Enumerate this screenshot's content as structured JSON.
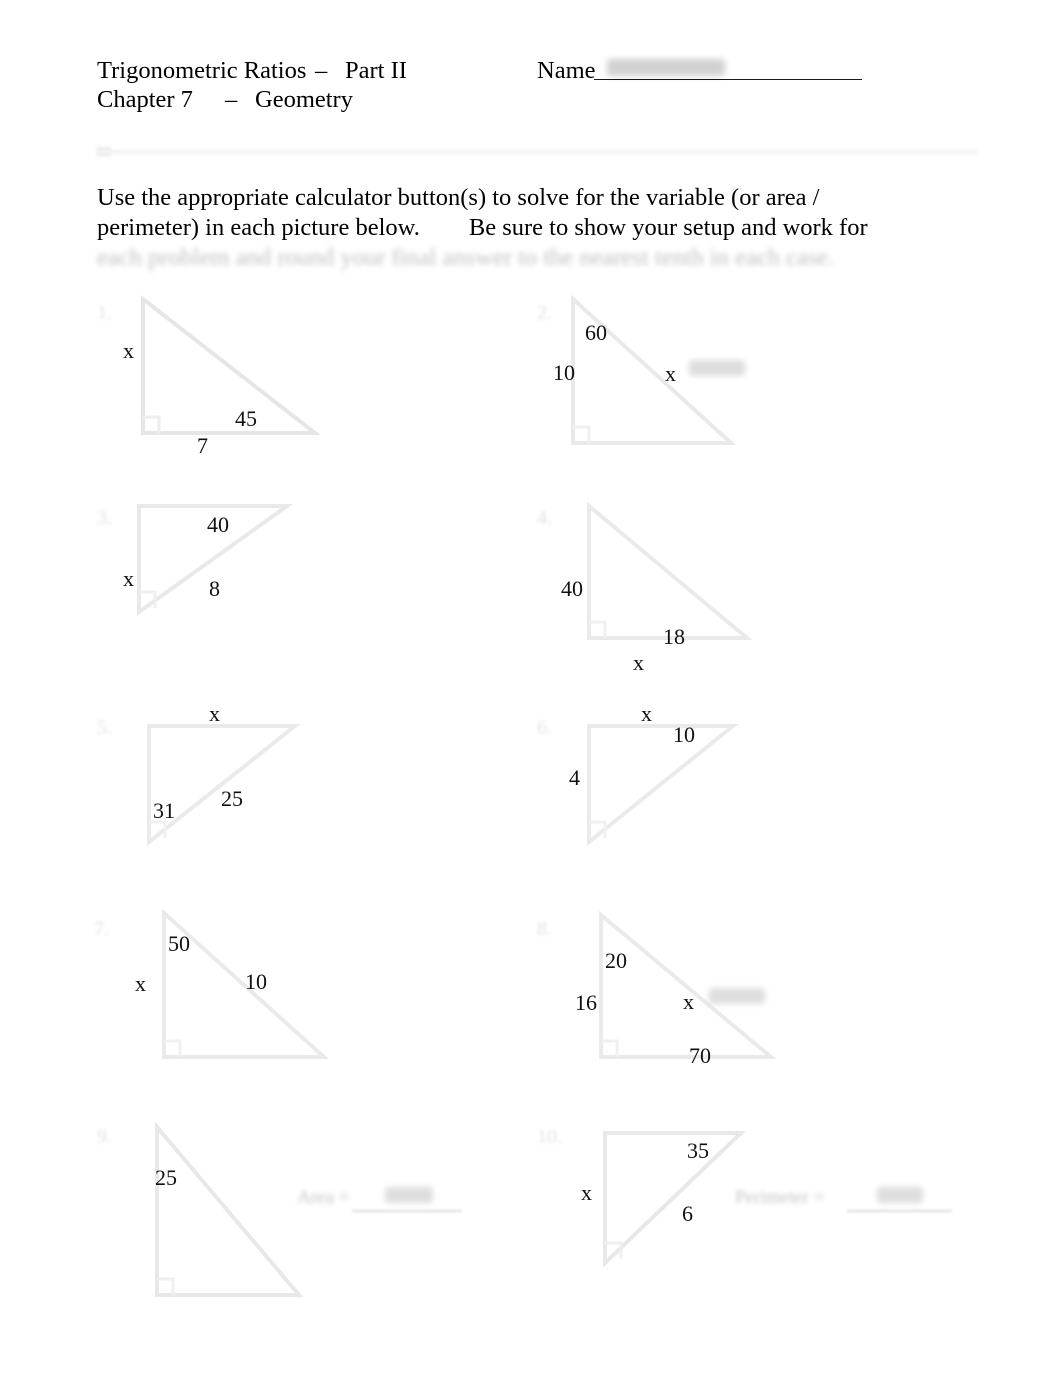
{
  "document": {
    "title_line1_left": "Trigonometric Ratios",
    "title_line1_dash": "–",
    "title_line1_part": "Part II",
    "title_line2_left": "Chapter 7",
    "title_line2_dash": "–",
    "title_line2_right": "Geometry",
    "name_label": "Name",
    "name_value": ""
  },
  "instructions": {
    "line1": "Use the appropriate calculator button(s) to solve for the variable (or area /",
    "line2": "perimeter) in each picture below.        Be sure to show your setup and work for",
    "line3": "each problem and round your final answer to the nearest tenth in each case."
  },
  "problems": [
    {
      "number": "1.",
      "labels": {
        "side_left": "x",
        "side_bottom": "7",
        "angle": "45"
      }
    },
    {
      "number": "2.",
      "labels": {
        "angle": "60",
        "side_left": "10",
        "hypotenuse": "x"
      }
    },
    {
      "number": "3.",
      "labels": {
        "angle": "40",
        "side_left": "x",
        "hypotenuse": "8"
      }
    },
    {
      "number": "4.",
      "labels": {
        "side_left": "40",
        "angle": "18",
        "side_bottom": "x"
      }
    },
    {
      "number": "5.",
      "labels": {
        "side_top": "x",
        "angle": "31",
        "hypotenuse": "25"
      }
    },
    {
      "number": "6.",
      "labels": {
        "side_top": "x",
        "angle": "10",
        "side_left": "4"
      }
    },
    {
      "number": "7.",
      "labels": {
        "angle": "50",
        "side_left": "x",
        "hypotenuse": "10"
      }
    },
    {
      "number": "8.",
      "labels": {
        "angle": "20",
        "side_left": "16",
        "hypotenuse": "x",
        "side_bottom": "70"
      }
    },
    {
      "number": "9.",
      "labels": {
        "side_left": "25"
      },
      "answer": {
        "label": "Area =",
        "value": ""
      }
    },
    {
      "number": "10.",
      "labels": {
        "angle": "35",
        "side_left": "x",
        "hypotenuse": "6"
      },
      "answer": {
        "label": "Perimeter =",
        "value": ""
      }
    }
  ]
}
